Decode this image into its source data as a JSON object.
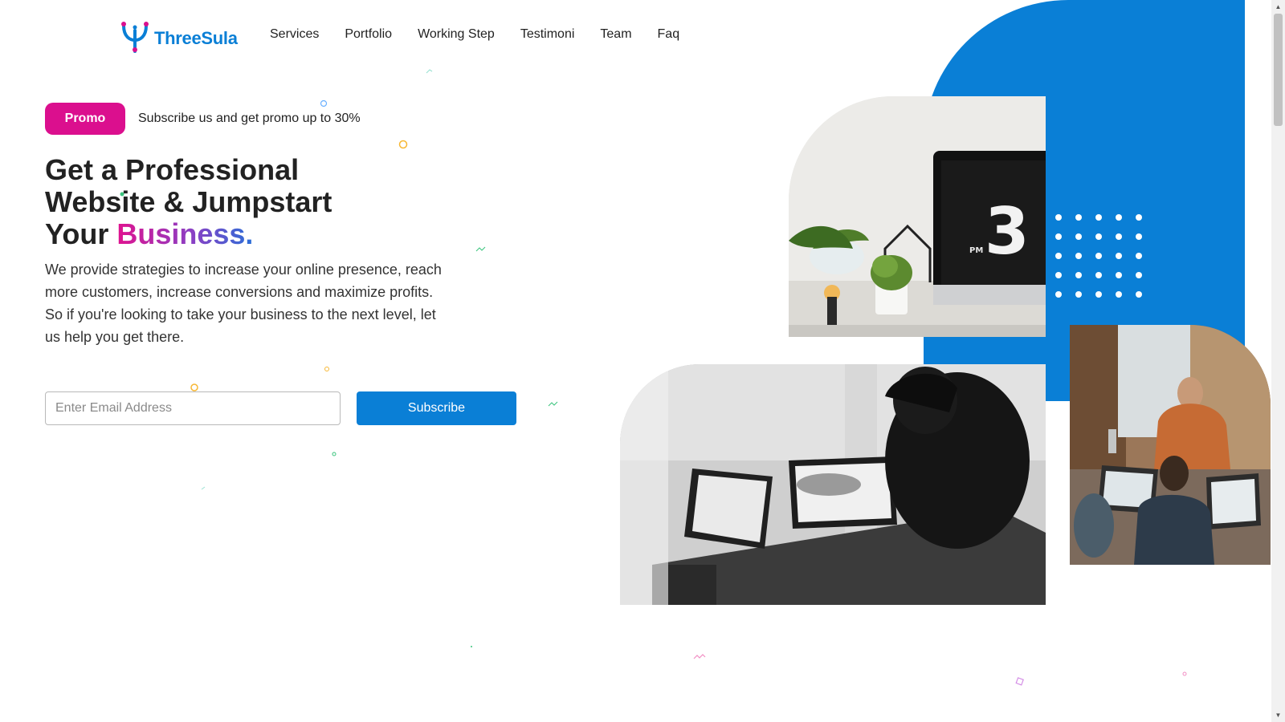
{
  "brand": {
    "name": "ThreeSula",
    "logo_icon": "trident-icon",
    "color": "#0a7fd6"
  },
  "nav": {
    "items": [
      {
        "label": "Services"
      },
      {
        "label": "Portfolio"
      },
      {
        "label": "Working Step"
      },
      {
        "label": "Testimoni"
      },
      {
        "label": "Team"
      },
      {
        "label": "Faq"
      }
    ]
  },
  "promo": {
    "badge": "Promo",
    "text": "Subscribe us and get promo up to 30%",
    "badge_color": "#db0f8e"
  },
  "hero": {
    "headline_line1": "Get a Professional",
    "headline_line2": "Website & Jumpstart",
    "headline_line3_prefix": "Your ",
    "headline_accent": "Business.",
    "description": "We provide strategies to increase your online presence, reach more customers, increase conversions and maximize profits. So if you're looking to take your business to the next level, let us help you get there."
  },
  "subscribe": {
    "placeholder": "Enter Email Address",
    "button_label": "Subscribe",
    "button_color": "#0a7fd6"
  },
  "images": {
    "office": {
      "clock_digit": "3",
      "clock_period": "PM"
    },
    "meeting": {},
    "team": {}
  }
}
